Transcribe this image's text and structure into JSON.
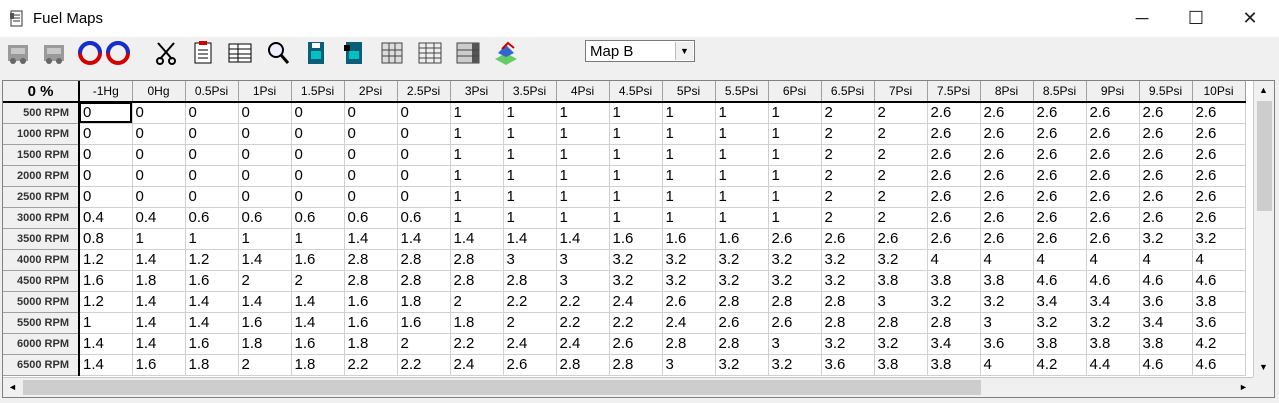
{
  "window": {
    "title": "Fuel Maps",
    "minimize_glyph": "─",
    "maximize_glyph": "☐",
    "close_glyph": "✕"
  },
  "toolbar": {
    "icons": [
      "car-grey-icon",
      "car-grey-icon-2",
      "swap-arrows-icon",
      "cut-icon",
      "paste-icon",
      "edit-table-icon",
      "zoom-icon",
      "chip-save-icon",
      "chip-load-icon",
      "grid-export-icon",
      "grid-icon",
      "grid-fill-icon",
      "3d-graph-icon"
    ],
    "map_select": {
      "value": "Map B",
      "options": [
        "Map B"
      ]
    }
  },
  "grid": {
    "corner": "0 %",
    "columns": [
      "-1Hg",
      "0Hg",
      "0.5Psi",
      "1Psi",
      "1.5Psi",
      "2Psi",
      "2.5Psi",
      "3Psi",
      "3.5Psi",
      "4Psi",
      "4.5Psi",
      "5Psi",
      "5.5Psi",
      "6Psi",
      "6.5Psi",
      "7Psi",
      "7.5Psi",
      "8Psi",
      "8.5Psi",
      "9Psi",
      "9.5Psi",
      "10Psi"
    ],
    "rows": [
      {
        "label": "500 RPM",
        "cells": [
          "0",
          "0",
          "0",
          "0",
          "0",
          "0",
          "0",
          "1",
          "1",
          "1",
          "1",
          "1",
          "1",
          "1",
          "2",
          "2",
          "2.6",
          "2.6",
          "2.6",
          "2.6",
          "2.6",
          "2.6"
        ]
      },
      {
        "label": "1000 RPM",
        "cells": [
          "0",
          "0",
          "0",
          "0",
          "0",
          "0",
          "0",
          "1",
          "1",
          "1",
          "1",
          "1",
          "1",
          "1",
          "2",
          "2",
          "2.6",
          "2.6",
          "2.6",
          "2.6",
          "2.6",
          "2.6"
        ]
      },
      {
        "label": "1500 RPM",
        "cells": [
          "0",
          "0",
          "0",
          "0",
          "0",
          "0",
          "0",
          "1",
          "1",
          "1",
          "1",
          "1",
          "1",
          "1",
          "2",
          "2",
          "2.6",
          "2.6",
          "2.6",
          "2.6",
          "2.6",
          "2.6"
        ]
      },
      {
        "label": "2000 RPM",
        "cells": [
          "0",
          "0",
          "0",
          "0",
          "0",
          "0",
          "0",
          "1",
          "1",
          "1",
          "1",
          "1",
          "1",
          "1",
          "2",
          "2",
          "2.6",
          "2.6",
          "2.6",
          "2.6",
          "2.6",
          "2.6"
        ]
      },
      {
        "label": "2500 RPM",
        "cells": [
          "0",
          "0",
          "0",
          "0",
          "0",
          "0",
          "0",
          "1",
          "1",
          "1",
          "1",
          "1",
          "1",
          "1",
          "2",
          "2",
          "2.6",
          "2.6",
          "2.6",
          "2.6",
          "2.6",
          "2.6"
        ]
      },
      {
        "label": "3000 RPM",
        "cells": [
          "0.4",
          "0.4",
          "0.6",
          "0.6",
          "0.6",
          "0.6",
          "0.6",
          "1",
          "1",
          "1",
          "1",
          "1",
          "1",
          "1",
          "2",
          "2",
          "2.6",
          "2.6",
          "2.6",
          "2.6",
          "2.6",
          "2.6"
        ]
      },
      {
        "label": "3500 RPM",
        "cells": [
          "0.8",
          "1",
          "1",
          "1",
          "1",
          "1.4",
          "1.4",
          "1.4",
          "1.4",
          "1.4",
          "1.6",
          "1.6",
          "1.6",
          "2.6",
          "2.6",
          "2.6",
          "2.6",
          "2.6",
          "2.6",
          "2.6",
          "3.2",
          "3.2"
        ]
      },
      {
        "label": "4000 RPM",
        "cells": [
          "1.2",
          "1.4",
          "1.2",
          "1.4",
          "1.6",
          "2.8",
          "2.8",
          "2.8",
          "3",
          "3",
          "3.2",
          "3.2",
          "3.2",
          "3.2",
          "3.2",
          "3.2",
          "4",
          "4",
          "4",
          "4",
          "4",
          "4"
        ]
      },
      {
        "label": "4500 RPM",
        "cells": [
          "1.6",
          "1.8",
          "1.6",
          "2",
          "2",
          "2.8",
          "2.8",
          "2.8",
          "2.8",
          "3",
          "3.2",
          "3.2",
          "3.2",
          "3.2",
          "3.2",
          "3.8",
          "3.8",
          "3.8",
          "4.6",
          "4.6",
          "4.6",
          "4.6"
        ]
      },
      {
        "label": "5000 RPM",
        "cells": [
          "1.2",
          "1.4",
          "1.4",
          "1.4",
          "1.4",
          "1.6",
          "1.8",
          "2",
          "2.2",
          "2.2",
          "2.4",
          "2.6",
          "2.8",
          "2.8",
          "2.8",
          "3",
          "3.2",
          "3.2",
          "3.4",
          "3.4",
          "3.6",
          "3.8"
        ]
      },
      {
        "label": "5500 RPM",
        "cells": [
          "1",
          "1.4",
          "1.4",
          "1.6",
          "1.4",
          "1.6",
          "1.6",
          "1.8",
          "2",
          "2.2",
          "2.2",
          "2.4",
          "2.6",
          "2.6",
          "2.8",
          "2.8",
          "2.8",
          "3",
          "3.2",
          "3.2",
          "3.4",
          "3.6"
        ]
      },
      {
        "label": "6000 RPM",
        "cells": [
          "1.4",
          "1.4",
          "1.6",
          "1.8",
          "1.6",
          "1.8",
          "2",
          "2.2",
          "2.4",
          "2.4",
          "2.6",
          "2.8",
          "2.8",
          "3",
          "3.2",
          "3.2",
          "3.4",
          "3.6",
          "3.8",
          "3.8",
          "3.8",
          "4.2"
        ]
      },
      {
        "label": "6500 RPM",
        "cells": [
          "1.4",
          "1.6",
          "1.8",
          "2",
          "1.8",
          "2.2",
          "2.2",
          "2.4",
          "2.6",
          "2.8",
          "2.8",
          "3",
          "3.2",
          "3.2",
          "3.6",
          "3.8",
          "3.8",
          "4",
          "4.2",
          "4.4",
          "4.6",
          "4.6"
        ]
      }
    ],
    "selected_cell": {
      "row": 0,
      "col": 0
    }
  },
  "scrollbars": {
    "up": "▲",
    "down": "▼",
    "left": "◄",
    "right": "►"
  }
}
